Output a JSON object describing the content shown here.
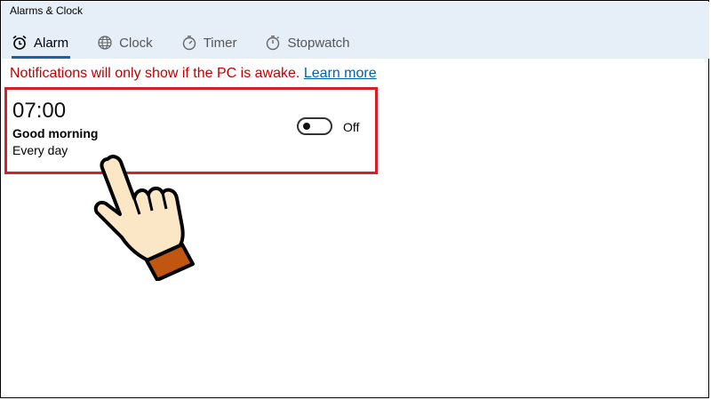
{
  "window": {
    "title": "Alarms & Clock"
  },
  "tabs": [
    {
      "label": "Alarm",
      "icon": "alarm-clock-icon",
      "active": true
    },
    {
      "label": "Clock",
      "icon": "globe-icon",
      "active": false
    },
    {
      "label": "Timer",
      "icon": "timer-icon",
      "active": false
    },
    {
      "label": "Stopwatch",
      "icon": "stopwatch-icon",
      "active": false
    }
  ],
  "notice": {
    "text": "Notifications will only show if the PC is awake.",
    "link": "Learn more"
  },
  "alarm": {
    "time": "07:00",
    "name": "Good morning",
    "repeat": "Every day",
    "toggle_label": "Off",
    "enabled": false
  },
  "colors": {
    "header_bg": "#e6eff8",
    "accent": "#1f5fa8",
    "notice": "#c00000",
    "link": "#0063b1",
    "highlight": "#d61f26",
    "hand_cuff": "#c0560f"
  }
}
